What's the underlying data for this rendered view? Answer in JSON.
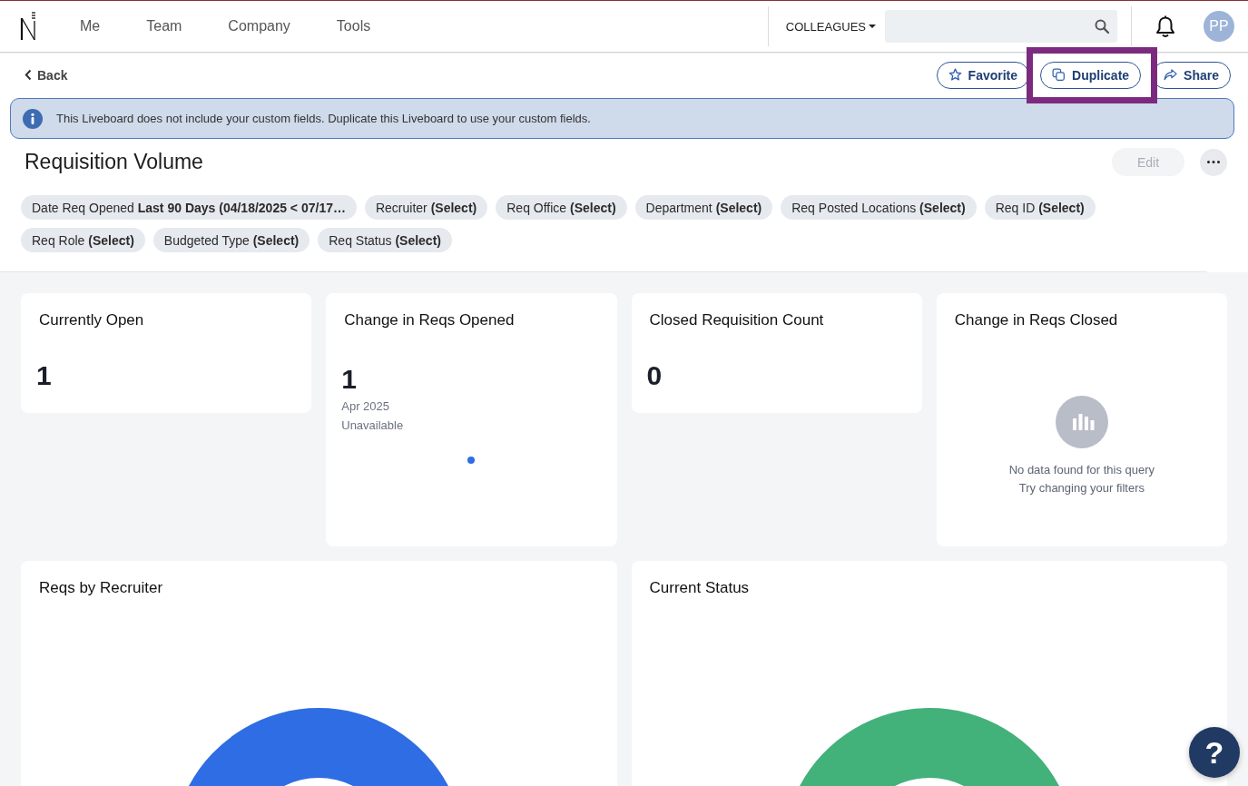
{
  "header": {
    "nav": [
      {
        "label": "Me"
      },
      {
        "label": "Team"
      },
      {
        "label": "Company"
      },
      {
        "label": "Tools"
      }
    ],
    "directory_menu": "COLLEAGUES",
    "avatar": "PP"
  },
  "toolbar": {
    "back": "Back",
    "actions": [
      {
        "kind": "favorite",
        "label": "Favorite",
        "highlighted": false
      },
      {
        "kind": "duplicate",
        "label": "Duplicate",
        "highlighted": true
      },
      {
        "kind": "share",
        "label": "Share",
        "highlighted": false
      }
    ]
  },
  "banner": {
    "message": "This Liveboard does not include your custom fields. Duplicate this Liveboard to use your custom fields."
  },
  "liveboard": {
    "title": "Requisition Volume",
    "edit": {
      "label": "Edit",
      "disabled": true
    },
    "filters": [
      {
        "label": "Date Req Opened",
        "value": "Last 90 Days (04/18/2025 < 07/17…"
      },
      {
        "label": "Recruiter",
        "value": "(Select)"
      },
      {
        "label": "Req Office",
        "value": "(Select)"
      },
      {
        "label": "Department",
        "value": "(Select)"
      },
      {
        "label": "Req Posted Locations",
        "value": "(Select)"
      },
      {
        "label": "Req ID",
        "value": "(Select)"
      },
      {
        "label": "Req Role",
        "value": "(Select)"
      },
      {
        "label": "Budgeted Type",
        "value": "(Select)"
      },
      {
        "label": "Req Status",
        "value": "(Select)"
      }
    ]
  },
  "cards": [
    {
      "kind": "number",
      "title": "Currently Open",
      "value": "1"
    },
    {
      "kind": "trend",
      "title": "Change in Reqs Opened",
      "value": "1",
      "period": "Apr 2025",
      "comparison": "Unavailable"
    },
    {
      "kind": "number",
      "title": "Closed Requisition Count",
      "value": "0"
    },
    {
      "kind": "empty",
      "title": "Change in Reqs Closed",
      "message": "No data found for this query",
      "hint": "Try changing your filters"
    },
    {
      "kind": "donut",
      "title": "Reqs by Recruiter",
      "color": "#2e6de3"
    },
    {
      "kind": "donut",
      "title": "Current Status",
      "color": "#42b17a"
    }
  ],
  "help": "?"
}
